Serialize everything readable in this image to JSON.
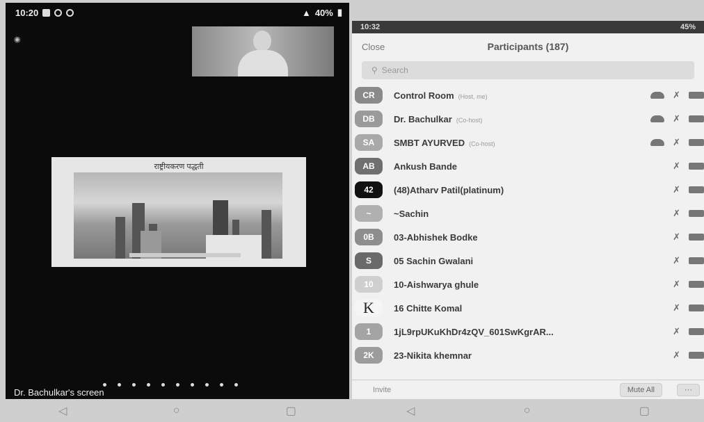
{
  "left_phone": {
    "status_time": "10:20",
    "status_right": "40%",
    "audio_label": "",
    "share_title": "राष्ट्रीयकरण पद्धती",
    "caption": "Dr. Bachulkar's screen"
  },
  "right_phone": {
    "status_time": "10:32",
    "status_right": "45%",
    "close_label": "Close",
    "title": "Participants (187)",
    "search_placeholder": "Search",
    "participants": [
      {
        "initials": "CR",
        "name": "Control Room",
        "role": "(Host, me)",
        "color": "#8a8a8a"
      },
      {
        "initials": "DB",
        "name": "Dr. Bachulkar",
        "role": "(Co-host)",
        "color": "#9a9a9a"
      },
      {
        "initials": "SA",
        "name": "SMBT AYURVED",
        "role": "(Co-host)",
        "color": "#a9a9a9"
      },
      {
        "initials": "AB",
        "name": "Ankush Bande",
        "role": "",
        "color": "#6f6f6f"
      },
      {
        "initials": "42",
        "name": "(48)Atharv Patil(platinum)",
        "role": "",
        "color": "#111111"
      },
      {
        "initials": "~",
        "name": "~Sachin",
        "role": "",
        "color": "#b0b0b0"
      },
      {
        "initials": "0B",
        "name": "03-Abhishek Bodke",
        "role": "",
        "color": "#8e8e8e"
      },
      {
        "initials": "S",
        "name": "05 Sachin Gwalani",
        "role": "",
        "color": "#6a6a6a"
      },
      {
        "initials": "10",
        "name": "10-Aishwarya ghule",
        "role": "",
        "color": "#cfcfcf"
      },
      {
        "initials": "K",
        "name": "16 Chitte Komal",
        "role": "",
        "color": "#f5f5f5"
      },
      {
        "initials": "1",
        "name": "1jL9rpUKuKhDr4zQV_601SwKgrAR...",
        "role": "",
        "color": "#a4a4a4"
      },
      {
        "initials": "2K",
        "name": "23-Nikita khemnar",
        "role": "",
        "color": "#9c9c9c"
      }
    ],
    "invite_label": "Invite",
    "mute_all_label": "Mute All",
    "more_label": "···"
  },
  "nav": {
    "back": "◁",
    "home": "○",
    "recents": "▢"
  }
}
